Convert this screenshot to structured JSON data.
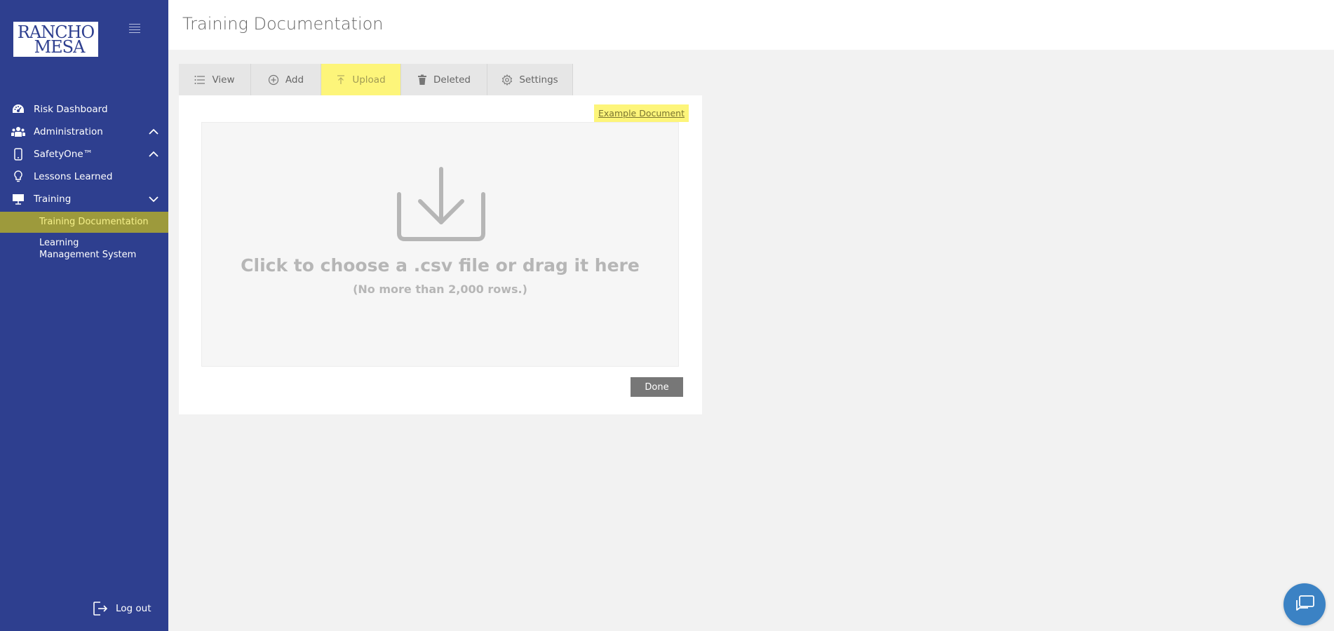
{
  "app": {
    "logo_line1": "RANCHO",
    "logo_line2": "MESA"
  },
  "sidebar": {
    "items": [
      {
        "label": "Risk Dashboard",
        "icon": "dashboard-icon"
      },
      {
        "label": "Administration",
        "icon": "users-icon",
        "expanded": false
      },
      {
        "label": "SafetyOne™",
        "icon": "mobile-icon",
        "expanded": false
      },
      {
        "label": "Lessons Learned",
        "icon": "lightbulb-icon"
      },
      {
        "label": "Training",
        "icon": "presentation-icon",
        "expanded": true
      }
    ],
    "sub_items": [
      {
        "label": "Training Documentation",
        "active": true
      },
      {
        "label": "Learning Management System",
        "active": false
      }
    ],
    "logout_label": "Log out"
  },
  "header": {
    "title": "Training Documentation"
  },
  "tabs": [
    {
      "label": "View",
      "icon": "list-icon"
    },
    {
      "label": "Add",
      "icon": "plus-circle-icon"
    },
    {
      "label": "Upload",
      "icon": "upload-icon",
      "active": true
    },
    {
      "label": "Deleted",
      "icon": "trash-icon"
    },
    {
      "label": "Settings",
      "icon": "gear-icon"
    }
  ],
  "upload": {
    "example_link": "Example Document",
    "drop_main": "Click to choose a .csv file or drag it here",
    "drop_sub": "(No more than 2,000 rows.)",
    "done_label": "Done"
  },
  "colors": {
    "sidebar_bg": "#2e3f8f",
    "active_highlight": "#fdf57a",
    "active_sidebar": "#9d9a3c",
    "chat_button": "#3b82c4"
  }
}
